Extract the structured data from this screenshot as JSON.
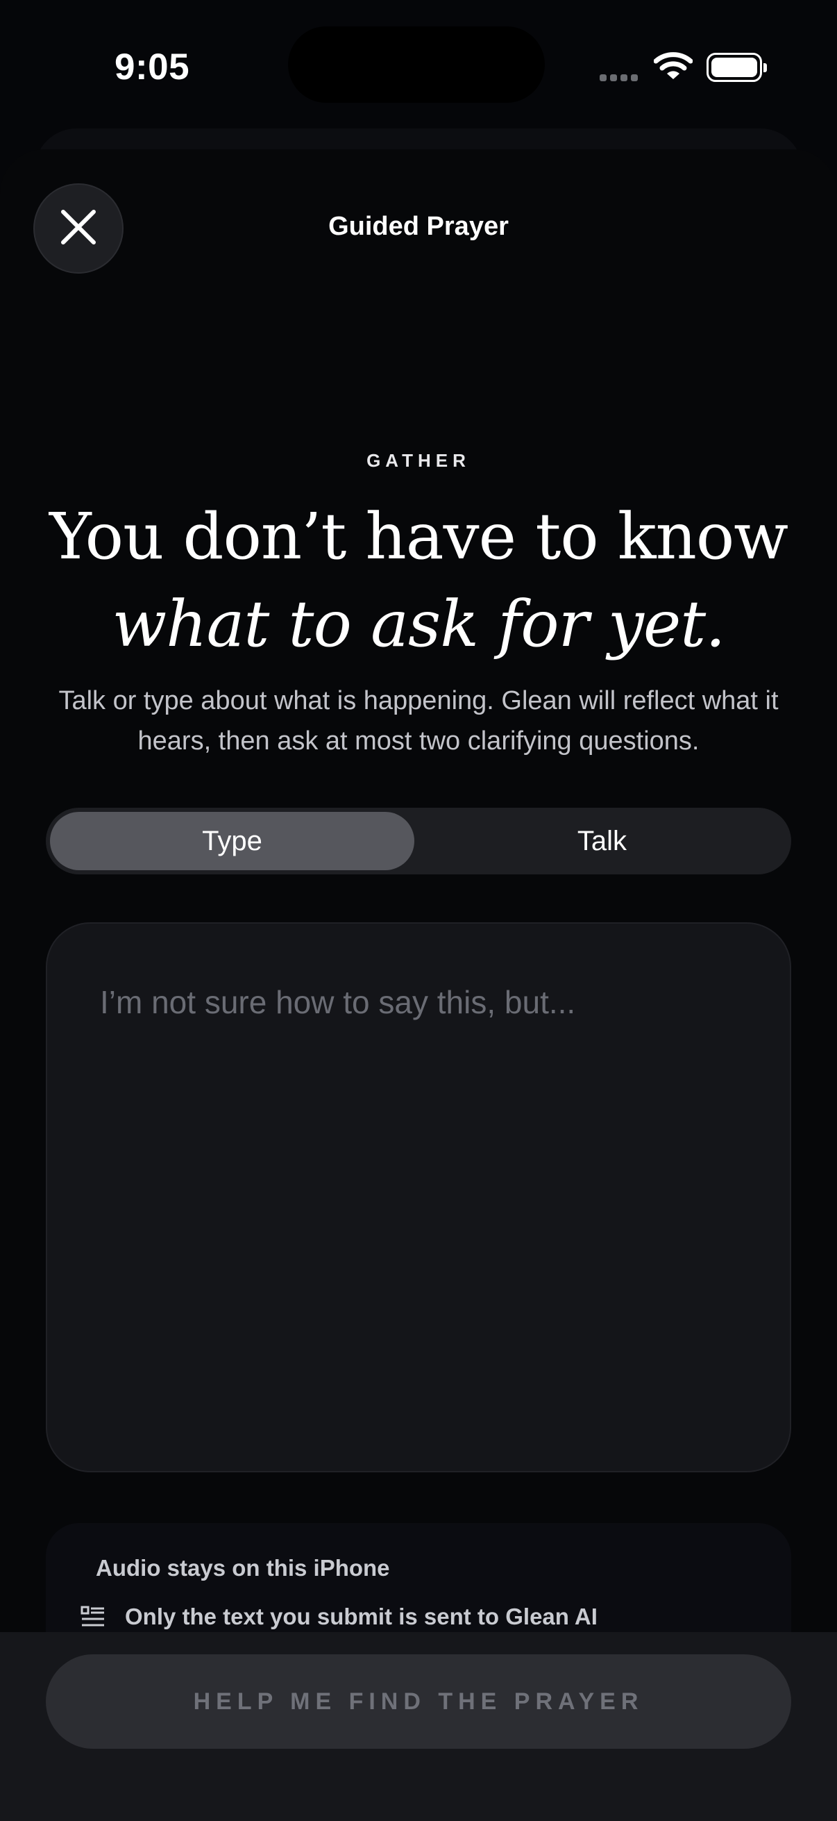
{
  "status_bar": {
    "time": "9:05",
    "icons": [
      "cellular-signal-icon",
      "wifi-icon",
      "battery-icon"
    ]
  },
  "header": {
    "title": "Guided Prayer",
    "close_icon": "close-icon"
  },
  "intro": {
    "eyebrow": "GATHER",
    "headline_line1": "You don’t have to know",
    "headline_line2": "what to ask for yet.",
    "subtext": "Talk or type about what is happening. Glean will reflect what it hears, then ask at most two clarifying questions."
  },
  "mode_toggle": {
    "options": [
      "Type",
      "Talk"
    ],
    "selected": "Type"
  },
  "input": {
    "value": "",
    "placeholder": "I’m not sure how to say this, but..."
  },
  "privacy": {
    "line1": "Audio stays on this iPhone",
    "line2": "Only the text you submit is sent to Glean AI",
    "line2_icon": "checklist-icon"
  },
  "footer": {
    "cta_label": "HELP ME FIND THE PRAYER"
  },
  "colors": {
    "background": "#050609",
    "segment_selected": "#56575d",
    "segment_track": "#1d1e22",
    "cta_background": "#2c2d32",
    "cta_text": "#6f7179"
  }
}
